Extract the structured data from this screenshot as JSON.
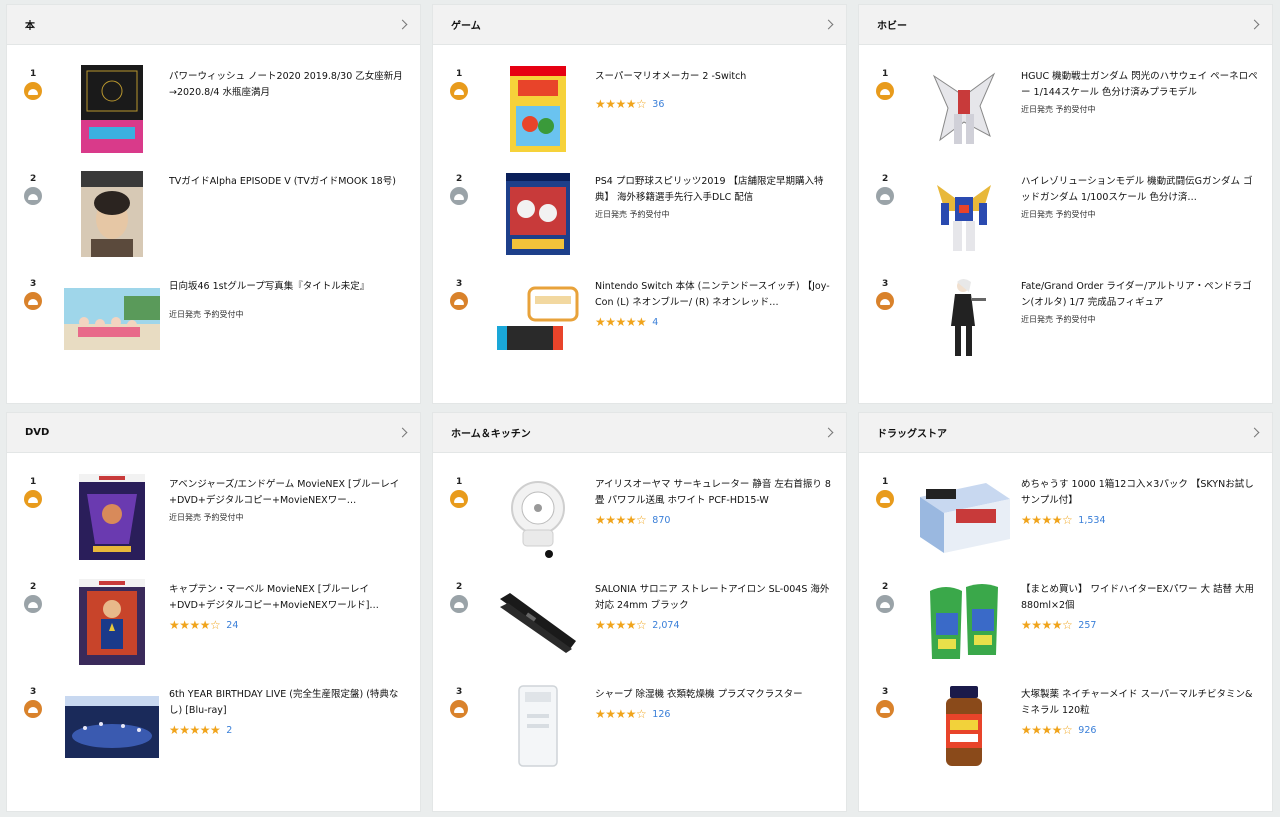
{
  "panels": [
    {
      "title": "本",
      "items": [
        {
          "rank": "1",
          "badge": "gold",
          "title": "パワーウィッシュ ノート2020 2019.8/30 乙女座新月→2020.8/4 水瓶座満月",
          "sub": "",
          "stars": "",
          "count": ""
        },
        {
          "rank": "2",
          "badge": "silver",
          "title": "TVガイドAlpha EPISODE V (TVガイドMOOK 18号)",
          "sub": "",
          "stars": "",
          "count": ""
        },
        {
          "rank": "3",
          "badge": "bronze",
          "title": "日向坂46 1stグループ写真集『タイトル未定』",
          "sub": "近日発売 予約受付中",
          "stars": "",
          "count": ""
        }
      ]
    },
    {
      "title": "ゲーム",
      "items": [
        {
          "rank": "1",
          "badge": "gold",
          "title": "スーパーマリオメーカー 2 -Switch",
          "sub": "",
          "stars": "★★★★☆",
          "count": "36"
        },
        {
          "rank": "2",
          "badge": "silver",
          "title": "PS4 プロ野球スピリッツ2019 【店舗限定早期購入特典】 海外移籍選手先行入手DLC 配信",
          "sub": "近日発売 予約受付中",
          "stars": "",
          "count": ""
        },
        {
          "rank": "3",
          "badge": "bronze",
          "title": "Nintendo Switch 本体 (ニンテンドースイッチ) 【Joy-Con (L) ネオンブルー/ (R) ネオンレッド…",
          "sub": "",
          "stars": "★★★★★",
          "count": "4"
        }
      ]
    },
    {
      "title": "ホビー",
      "items": [
        {
          "rank": "1",
          "badge": "gold",
          "title": "HGUC 機動戦士ガンダム 閃光のハサウェイ ペーネロペー 1/144スケール 色分け済みプラモデル",
          "sub": "近日発売 予約受付中",
          "stars": "",
          "count": ""
        },
        {
          "rank": "2",
          "badge": "silver",
          "title": "ハイレゾリューションモデル 機動武闘伝Gガンダム ゴッドガンダム 1/100スケール 色分け済…",
          "sub": "近日発売 予約受付中",
          "stars": "",
          "count": ""
        },
        {
          "rank": "3",
          "badge": "bronze",
          "title": "Fate/Grand Order ライダー/アルトリア・ペンドラゴン(オルタ) 1/7 完成品フィギュア",
          "sub": "近日発売 予約受付中",
          "stars": "",
          "count": ""
        }
      ]
    },
    {
      "title": "DVD",
      "items": [
        {
          "rank": "1",
          "badge": "gold",
          "title": "アベンジャーズ/エンドゲーム MovieNEX [ブルーレイ+DVD+デジタルコピー+MovieNEXワー…",
          "sub": "近日発売 予約受付中",
          "stars": "",
          "count": ""
        },
        {
          "rank": "2",
          "badge": "silver",
          "title": "キャプテン・マーベル MovieNEX [ブルーレイ+DVD+デジタルコピー+MovieNEXワールド]…",
          "sub": "",
          "stars": "★★★★☆",
          "count": "24"
        },
        {
          "rank": "3",
          "badge": "bronze",
          "title": "6th YEAR BIRTHDAY LIVE (完全生産限定盤) (特典なし) [Blu-ray]",
          "sub": "",
          "stars": "★★★★★",
          "count": "2"
        }
      ]
    },
    {
      "title": "ホーム＆キッチン",
      "items": [
        {
          "rank": "1",
          "badge": "gold",
          "title": "アイリスオーヤマ サーキュレーター 静音 左右首振り 8畳 パワフル送風 ホワイト PCF-HD15-W",
          "sub": "",
          "stars": "★★★★☆",
          "count": "870"
        },
        {
          "rank": "2",
          "badge": "silver",
          "title": "SALONIA サロニア ストレートアイロン SL-004S 海外対応 24mm ブラック",
          "sub": "",
          "stars": "★★★★☆",
          "count": "2,074"
        },
        {
          "rank": "3",
          "badge": "bronze",
          "title": "シャープ 除湿機 衣類乾燥機 プラズマクラスター",
          "sub": "",
          "stars": "★★★★☆",
          "count": "126"
        }
      ]
    },
    {
      "title": "ドラッグストア",
      "items": [
        {
          "rank": "1",
          "badge": "gold",
          "title": "めちゃうす 1000 1箱12コ入×3パック 【SKYNお試しサンプル付】",
          "sub": "",
          "stars": "★★★★☆",
          "count": "1,534"
        },
        {
          "rank": "2",
          "badge": "silver",
          "title": "【まとめ買い】 ワイドハイターEXパワー 大 詰替 大用880ml×2個",
          "sub": "",
          "stars": "★★★★☆",
          "count": "257"
        },
        {
          "rank": "3",
          "badge": "bronze",
          "title": "大塚製薬 ネイチャーメイド スーパーマルチビタミン&ミネラル 120粒",
          "sub": "",
          "stars": "★★★★☆",
          "count": "926"
        }
      ]
    }
  ],
  "colors": {
    "gold": "#e89b1c",
    "silver": "#9aa3a8",
    "bronze": "#d9822b",
    "star": "#f0a41c",
    "link": "#3a7fd8"
  }
}
